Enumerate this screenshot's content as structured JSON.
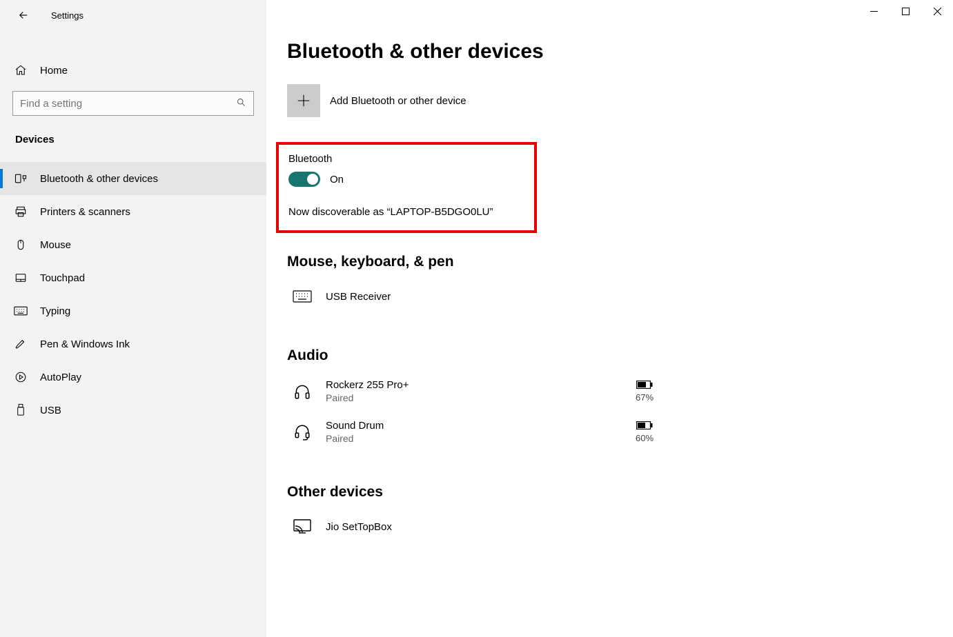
{
  "app": {
    "title": "Settings"
  },
  "sidebar": {
    "home_label": "Home",
    "search_placeholder": "Find a setting",
    "category": "Devices",
    "items": [
      {
        "label": "Bluetooth & other devices"
      },
      {
        "label": "Printers & scanners"
      },
      {
        "label": "Mouse"
      },
      {
        "label": "Touchpad"
      },
      {
        "label": "Typing"
      },
      {
        "label": "Pen & Windows Ink"
      },
      {
        "label": "AutoPlay"
      },
      {
        "label": "USB"
      }
    ]
  },
  "main": {
    "page_title": "Bluetooth & other devices",
    "add_device": "Add Bluetooth or other device",
    "bluetooth": {
      "label": "Bluetooth",
      "state": "On",
      "discoverable": "Now discoverable as “LAPTOP-B5DGO0LU”"
    },
    "sections": {
      "mouse_kb_pen": {
        "title": "Mouse, keyboard, & pen",
        "devices": [
          {
            "name": "USB Receiver"
          }
        ]
      },
      "audio": {
        "title": "Audio",
        "devices": [
          {
            "name": "Rockerz 255 Pro+",
            "status": "Paired",
            "battery": "67%"
          },
          {
            "name": "Sound Drum",
            "status": "Paired",
            "battery": "60%"
          }
        ]
      },
      "other": {
        "title": "Other devices",
        "devices": [
          {
            "name": "Jio SetTopBox"
          }
        ]
      }
    }
  }
}
